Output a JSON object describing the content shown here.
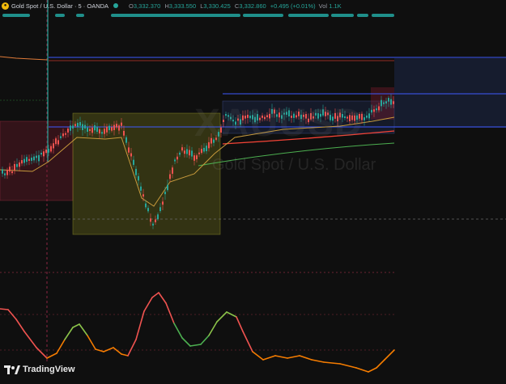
{
  "header": {
    "symbol": "Gold Spot / U.S. Dollar · 5 · OANDA",
    "open_label": "O",
    "open": "3,332.370",
    "high_label": "H",
    "high": "3,333.550",
    "low_label": "L",
    "low": "3,330.425",
    "close_label": "C",
    "close": "3,332.860",
    "change": "+0.495 (+0.01%)",
    "vol_label": "Vol",
    "vol": "1.1K"
  },
  "watermark": {
    "ticker": "XAUUSD",
    "description": "Gold Spot / U.S. Dollar"
  },
  "branding": {
    "logo_text": "TradingView"
  },
  "colors": {
    "up": "#26a69a",
    "down": "#ef5350",
    "background": "#0f0f0f",
    "hline": "#3d5afe",
    "ema_red": "#f44336",
    "ema_green": "#4caf50"
  }
}
